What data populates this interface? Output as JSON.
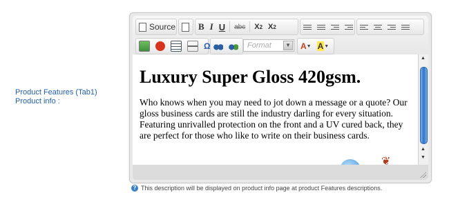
{
  "field": {
    "label": "Product Features (Tab1) Product info :"
  },
  "toolbar": {
    "source_label": "Source",
    "bold_label": "B",
    "italic_label": "I",
    "underline_label": "U",
    "strike_label": "abc",
    "subscript_label": "X",
    "subscript_mark": "2",
    "superscript_label": "X",
    "superscript_mark": "2",
    "format_placeholder": "Format",
    "text_color_label": "A",
    "bg_color_label": "A",
    "special_char_label": "Ω"
  },
  "content": {
    "heading": "Luxury Super Gloss 420gsm.",
    "paragraph": "Who knows when you may need to jot down a message or a quote?  Our gloss business cards are still the industry darling for every situation. Featuring unrivalled protection on the front and a UV cured back, they are perfect for those who like to write on their business cards."
  },
  "hint": {
    "text": "This description will be displayed on product info page at product Features descriptions."
  },
  "colors": {
    "label_blue": "#1f5fa8",
    "scroll_blue": "#2f74c8"
  }
}
